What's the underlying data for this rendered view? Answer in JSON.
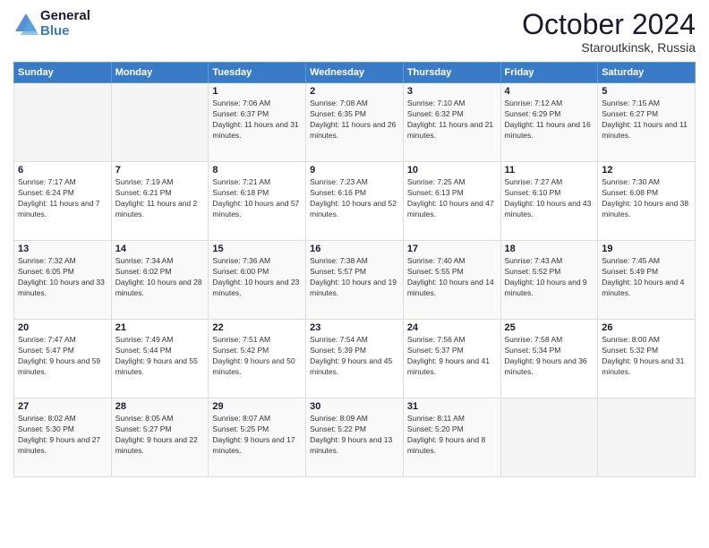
{
  "header": {
    "logo_line1": "General",
    "logo_line2": "Blue",
    "month": "October 2024",
    "location": "Staroutkinsk, Russia"
  },
  "weekdays": [
    "Sunday",
    "Monday",
    "Tuesday",
    "Wednesday",
    "Thursday",
    "Friday",
    "Saturday"
  ],
  "weeks": [
    [
      {
        "day": "",
        "info": ""
      },
      {
        "day": "",
        "info": ""
      },
      {
        "day": "1",
        "info": "Sunrise: 7:06 AM\nSunset: 6:37 PM\nDaylight: 11 hours and 31 minutes."
      },
      {
        "day": "2",
        "info": "Sunrise: 7:08 AM\nSunset: 6:35 PM\nDaylight: 11 hours and 26 minutes."
      },
      {
        "day": "3",
        "info": "Sunrise: 7:10 AM\nSunset: 6:32 PM\nDaylight: 11 hours and 21 minutes."
      },
      {
        "day": "4",
        "info": "Sunrise: 7:12 AM\nSunset: 6:29 PM\nDaylight: 11 hours and 16 minutes."
      },
      {
        "day": "5",
        "info": "Sunrise: 7:15 AM\nSunset: 6:27 PM\nDaylight: 11 hours and 11 minutes."
      }
    ],
    [
      {
        "day": "6",
        "info": "Sunrise: 7:17 AM\nSunset: 6:24 PM\nDaylight: 11 hours and 7 minutes."
      },
      {
        "day": "7",
        "info": "Sunrise: 7:19 AM\nSunset: 6:21 PM\nDaylight: 11 hours and 2 minutes."
      },
      {
        "day": "8",
        "info": "Sunrise: 7:21 AM\nSunset: 6:18 PM\nDaylight: 10 hours and 57 minutes."
      },
      {
        "day": "9",
        "info": "Sunrise: 7:23 AM\nSunset: 6:16 PM\nDaylight: 10 hours and 52 minutes."
      },
      {
        "day": "10",
        "info": "Sunrise: 7:25 AM\nSunset: 6:13 PM\nDaylight: 10 hours and 47 minutes."
      },
      {
        "day": "11",
        "info": "Sunrise: 7:27 AM\nSunset: 6:10 PM\nDaylight: 10 hours and 43 minutes."
      },
      {
        "day": "12",
        "info": "Sunrise: 7:30 AM\nSunset: 6:08 PM\nDaylight: 10 hours and 38 minutes."
      }
    ],
    [
      {
        "day": "13",
        "info": "Sunrise: 7:32 AM\nSunset: 6:05 PM\nDaylight: 10 hours and 33 minutes."
      },
      {
        "day": "14",
        "info": "Sunrise: 7:34 AM\nSunset: 6:02 PM\nDaylight: 10 hours and 28 minutes."
      },
      {
        "day": "15",
        "info": "Sunrise: 7:36 AM\nSunset: 6:00 PM\nDaylight: 10 hours and 23 minutes."
      },
      {
        "day": "16",
        "info": "Sunrise: 7:38 AM\nSunset: 5:57 PM\nDaylight: 10 hours and 19 minutes."
      },
      {
        "day": "17",
        "info": "Sunrise: 7:40 AM\nSunset: 5:55 PM\nDaylight: 10 hours and 14 minutes."
      },
      {
        "day": "18",
        "info": "Sunrise: 7:43 AM\nSunset: 5:52 PM\nDaylight: 10 hours and 9 minutes."
      },
      {
        "day": "19",
        "info": "Sunrise: 7:45 AM\nSunset: 5:49 PM\nDaylight: 10 hours and 4 minutes."
      }
    ],
    [
      {
        "day": "20",
        "info": "Sunrise: 7:47 AM\nSunset: 5:47 PM\nDaylight: 9 hours and 59 minutes."
      },
      {
        "day": "21",
        "info": "Sunrise: 7:49 AM\nSunset: 5:44 PM\nDaylight: 9 hours and 55 minutes."
      },
      {
        "day": "22",
        "info": "Sunrise: 7:51 AM\nSunset: 5:42 PM\nDaylight: 9 hours and 50 minutes."
      },
      {
        "day": "23",
        "info": "Sunrise: 7:54 AM\nSunset: 5:39 PM\nDaylight: 9 hours and 45 minutes."
      },
      {
        "day": "24",
        "info": "Sunrise: 7:56 AM\nSunset: 5:37 PM\nDaylight: 9 hours and 41 minutes."
      },
      {
        "day": "25",
        "info": "Sunrise: 7:58 AM\nSunset: 5:34 PM\nDaylight: 9 hours and 36 minutes."
      },
      {
        "day": "26",
        "info": "Sunrise: 8:00 AM\nSunset: 5:32 PM\nDaylight: 9 hours and 31 minutes."
      }
    ],
    [
      {
        "day": "27",
        "info": "Sunrise: 8:02 AM\nSunset: 5:30 PM\nDaylight: 9 hours and 27 minutes."
      },
      {
        "day": "28",
        "info": "Sunrise: 8:05 AM\nSunset: 5:27 PM\nDaylight: 9 hours and 22 minutes."
      },
      {
        "day": "29",
        "info": "Sunrise: 8:07 AM\nSunset: 5:25 PM\nDaylight: 9 hours and 17 minutes."
      },
      {
        "day": "30",
        "info": "Sunrise: 8:09 AM\nSunset: 5:22 PM\nDaylight: 9 hours and 13 minutes."
      },
      {
        "day": "31",
        "info": "Sunrise: 8:11 AM\nSunset: 5:20 PM\nDaylight: 9 hours and 8 minutes."
      },
      {
        "day": "",
        "info": ""
      },
      {
        "day": "",
        "info": ""
      }
    ]
  ]
}
